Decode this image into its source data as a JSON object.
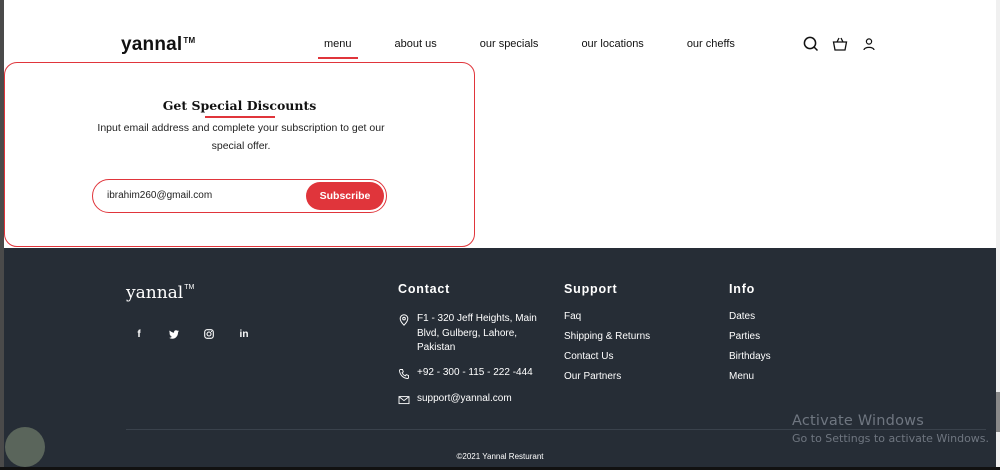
{
  "header": {
    "logo": "yannal",
    "logo_mark": "TM",
    "nav": [
      {
        "label": "menu",
        "active": true
      },
      {
        "label": "about us",
        "active": false
      },
      {
        "label": "our specials",
        "active": false
      },
      {
        "label": "our locations",
        "active": false
      },
      {
        "label": "our cheffs",
        "active": false
      }
    ],
    "icons": [
      "search-icon",
      "shopping-basket-icon",
      "user-icon"
    ]
  },
  "subscribe": {
    "title": "Get Special Discounts",
    "description": "Input email address and complete your subscription to get our special offer.",
    "email_value": "ibrahim260@gmail.com",
    "button_label": "Subscribe"
  },
  "footer": {
    "logo": "yannal",
    "logo_mark": "TM",
    "social": [
      "facebook-icon",
      "twitter-icon",
      "instagram-icon",
      "linkedin-icon"
    ],
    "contact": {
      "heading": "Contact",
      "address": "F1 - 320 Jeff Heights, Main Blvd, Gulberg, Lahore, Pakistan",
      "phone": "+92 - 300 - 115 - 222 -444",
      "email": "support@yannal.com"
    },
    "support": {
      "heading": "Support",
      "links": [
        "Faq",
        "Shipping & Returns",
        "Contact Us",
        "Our Partners"
      ]
    },
    "info": {
      "heading": "Info",
      "links": [
        "Dates",
        "Parties",
        "Birthdays",
        "Menu"
      ]
    },
    "copyright": "©2021 Yannal Resturant"
  },
  "system": {
    "activate_title": "Activate Windows",
    "activate_sub": "Go to Settings to activate Windows."
  },
  "colors": {
    "accent": "#e0353b",
    "footer_bg": "#262d36"
  }
}
